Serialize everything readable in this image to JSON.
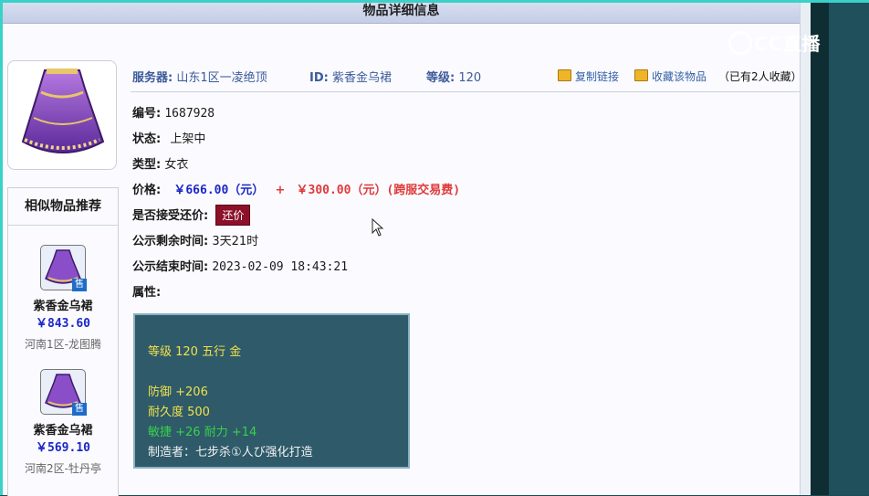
{
  "title": "物品详细信息",
  "info_bar": {
    "server_label": "服务器:",
    "server_value": "山东1区一凌绝顶",
    "id_label": "ID:",
    "id_value": "紫香金乌裙",
    "level_label": "等级:",
    "level_value": "120",
    "copy_link": "复制链接",
    "favorite": "收藏该物品",
    "fav_count": "（已有2人收藏）"
  },
  "details": {
    "number_label": "编号:",
    "number_value": "1687928",
    "status_label": "状态:",
    "status_value": "上架中",
    "type_label": "类型:",
    "type_value": "女衣",
    "price_label": "价格:",
    "price_main": "￥666.00（元）",
    "price_plus": "+",
    "price_fee": "￥300.00（元）(跨服交易费)",
    "bargain_label": "是否接受还价:",
    "bargain_button": "还价",
    "remaining_label": "公示剩余时间:",
    "remaining_value": "3天21时",
    "end_label": "公示结束时间:",
    "end_value": "2023-02-09 18:43:21",
    "attr_label": "属性:"
  },
  "attributes": {
    "line1": "等级 120 五行 金",
    "line2": "防御 +206",
    "line3": "耐久度 500",
    "line4": "敏捷 +26 耐力 +14",
    "line5": "制造者：七步杀①人び强化打造"
  },
  "sidebar": {
    "title": "相似物品推荐",
    "items": [
      {
        "name": "紫香金乌裙",
        "price": "￥843.60",
        "server": "河南1区-龙图腾",
        "badge": "售"
      },
      {
        "name": "紫香金乌裙",
        "price": "￥569.10",
        "server": "河南2区-牡丹亭",
        "badge": "售"
      }
    ]
  },
  "watermark": "CC直播",
  "colors": {
    "accent_blue": "#1b27c7",
    "price_red": "#e03a3a",
    "bargain_button_bg": "#8c1029",
    "attr_box_bg": "#2e5a6a"
  }
}
